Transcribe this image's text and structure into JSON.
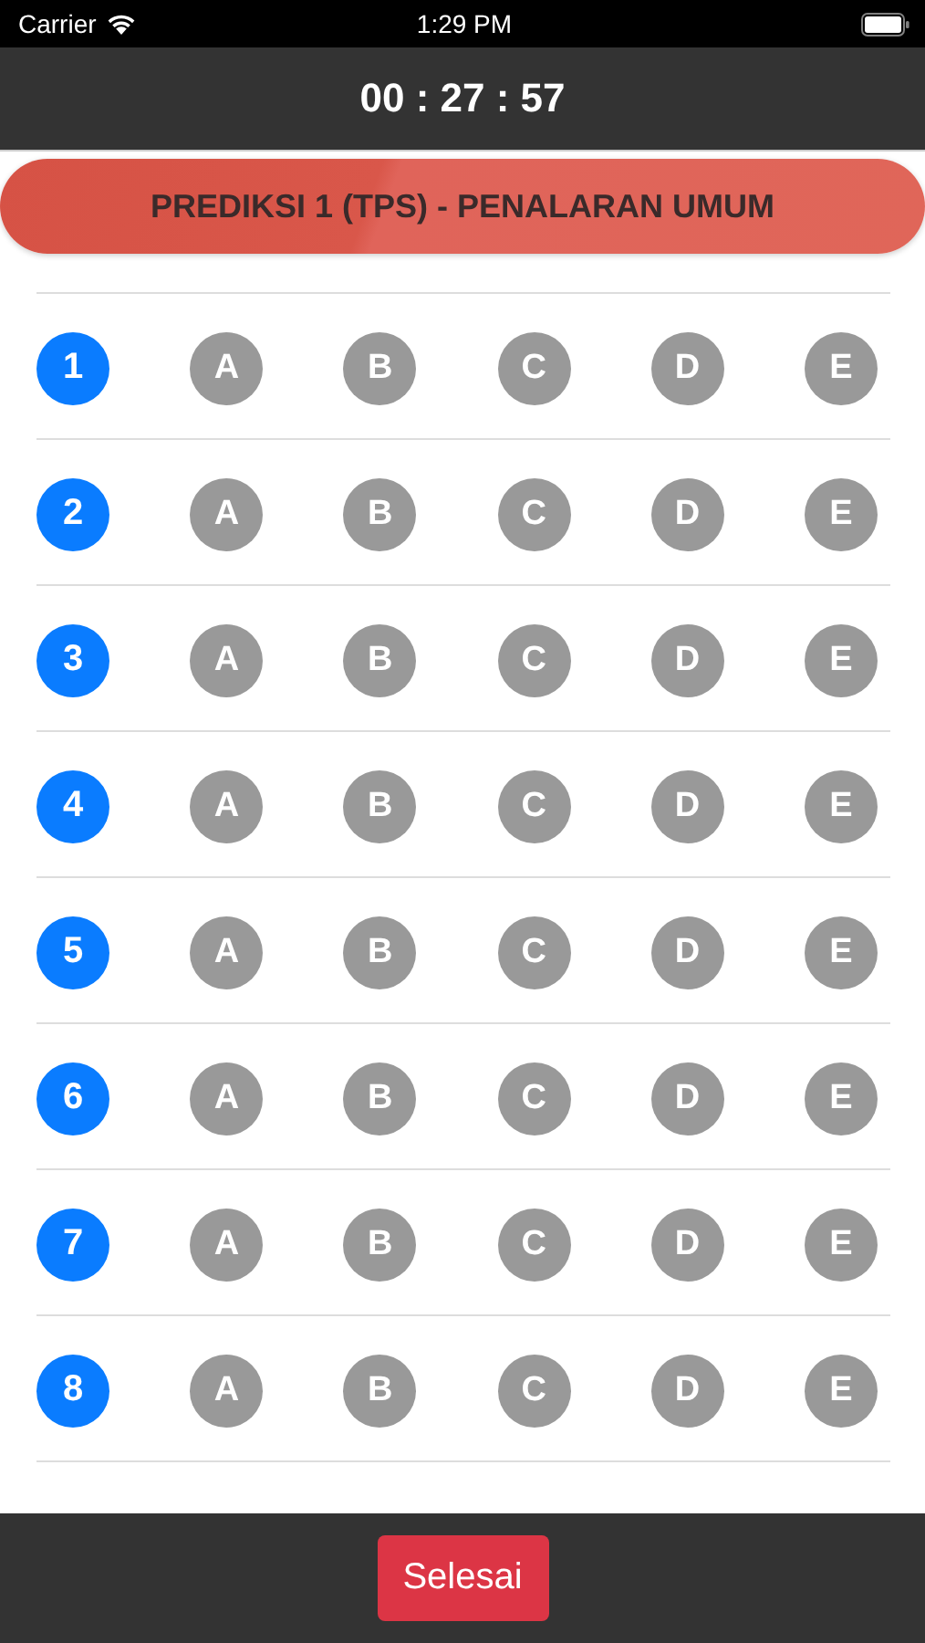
{
  "status_bar": {
    "carrier": "Carrier",
    "time": "1:29 PM"
  },
  "timer": "00 : 27 : 57",
  "title": "PREDIKSI 1 (TPS) - PENALARAN UMUM",
  "questions": [
    {
      "number": "1",
      "options": [
        {
          "label": "A",
          "selected": false
        },
        {
          "label": "B",
          "selected": false
        },
        {
          "label": "C",
          "selected": false
        },
        {
          "label": "D",
          "selected": false
        },
        {
          "label": "E",
          "selected": false
        }
      ]
    },
    {
      "number": "2",
      "options": [
        {
          "label": "A",
          "selected": false
        },
        {
          "label": "B",
          "selected": false
        },
        {
          "label": "C",
          "selected": false
        },
        {
          "label": "D",
          "selected": false
        },
        {
          "label": "E",
          "selected": false
        }
      ]
    },
    {
      "number": "3",
      "options": [
        {
          "label": "A",
          "selected": false
        },
        {
          "label": "B",
          "selected": false
        },
        {
          "label": "C",
          "selected": false
        },
        {
          "label": "D",
          "selected": false
        },
        {
          "label": "E",
          "selected": false
        }
      ]
    },
    {
      "number": "4",
      "options": [
        {
          "label": "A",
          "selected": false
        },
        {
          "label": "B",
          "selected": false
        },
        {
          "label": "C",
          "selected": false
        },
        {
          "label": "D",
          "selected": false
        },
        {
          "label": "E",
          "selected": false
        }
      ]
    },
    {
      "number": "5",
      "options": [
        {
          "label": "A",
          "selected": false
        },
        {
          "label": "B",
          "selected": false
        },
        {
          "label": "C",
          "selected": false
        },
        {
          "label": "D",
          "selected": false
        },
        {
          "label": "E",
          "selected": false
        }
      ]
    },
    {
      "number": "6",
      "options": [
        {
          "label": "A",
          "selected": false
        },
        {
          "label": "B",
          "selected": false
        },
        {
          "label": "C",
          "selected": false
        },
        {
          "label": "D",
          "selected": false
        },
        {
          "label": "E",
          "selected": false
        }
      ]
    },
    {
      "number": "7",
      "options": [
        {
          "label": "A",
          "selected": false
        },
        {
          "label": "B",
          "selected": false
        },
        {
          "label": "C",
          "selected": false
        },
        {
          "label": "D",
          "selected": false
        },
        {
          "label": "E",
          "selected": false
        }
      ]
    },
    {
      "number": "8",
      "options": [
        {
          "label": "A",
          "selected": false
        },
        {
          "label": "B",
          "selected": false
        },
        {
          "label": "C",
          "selected": false
        },
        {
          "label": "D",
          "selected": false
        },
        {
          "label": "E",
          "selected": false
        }
      ]
    }
  ],
  "finish_button": "Selesai"
}
